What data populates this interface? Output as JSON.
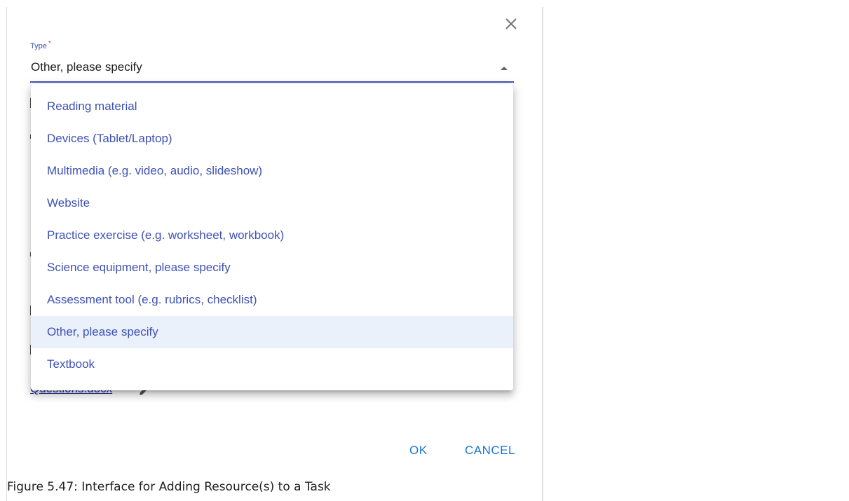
{
  "dialog": {
    "field_label": "Type",
    "required_marker": "*",
    "selected_value": "Other, please specify",
    "options": [
      "Reading material",
      "Devices (Tablet/Laptop)",
      "Multimedia (e.g. video, audio, slideshow)",
      "Website",
      "Practice exercise (e.g. worksheet, workbook)",
      "Science equipment, please specify",
      "Assessment tool (e.g. rubrics, checklist)",
      "Other, please specify",
      "Textbook"
    ],
    "selected_index": 7,
    "attachment_text": "Questions.docx",
    "ok_label": "OK",
    "cancel_label": "CANCEL"
  },
  "caption": "Figure 5.47: Interface for Adding Resource(s) to a Task",
  "colors": {
    "accent": "#3f51b5",
    "button_text": "#1976d2",
    "selected_bg": "#eaf1fa"
  },
  "icons": {
    "close": "close-icon",
    "dropdown_arrow": "arrow-up-icon",
    "edit": "pencil-icon"
  }
}
